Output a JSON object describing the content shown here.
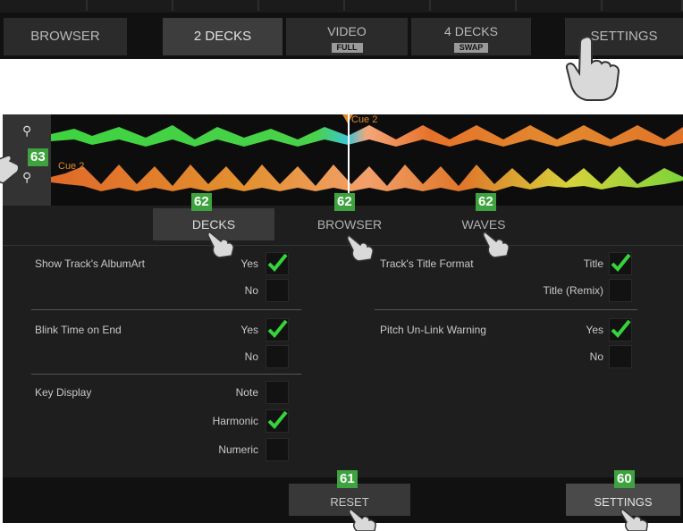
{
  "topnav": {
    "buttons": [
      {
        "label": "BROWSER"
      },
      {
        "label": "2 DECKS"
      },
      {
        "label": "VIDEO",
        "sublabel": "FULL"
      },
      {
        "label": "4 DECKS",
        "sublabel": "SWAP"
      },
      {
        "label": "SETTINGS"
      }
    ],
    "active": "2 DECKS"
  },
  "waveform": {
    "cue_top": "Cue 2",
    "cue_bottom": "Cue 2",
    "badge": "63",
    "colors": {
      "green": "#35c93a",
      "orange": "#e0762a",
      "yellow": "#d6d23c",
      "cyan": "#3bc7d6"
    }
  },
  "tabs": {
    "items": [
      {
        "label": "DECKS",
        "badge": "62"
      },
      {
        "label": "BROWSER",
        "badge": "62"
      },
      {
        "label": "WAVES",
        "badge": "62"
      }
    ],
    "active": "DECKS"
  },
  "settings": {
    "left": [
      {
        "label": "Show Track's AlbumArt",
        "options": [
          {
            "label": "Yes",
            "checked": true
          },
          {
            "label": "No",
            "checked": false
          }
        ]
      },
      {
        "label": "Blink Time on End",
        "options": [
          {
            "label": "Yes",
            "checked": true
          },
          {
            "label": "No",
            "checked": false
          }
        ]
      },
      {
        "label": "Key Display",
        "options": [
          {
            "label": "Note",
            "checked": false
          },
          {
            "label": "Harmonic",
            "checked": true
          },
          {
            "label": "Numeric",
            "checked": false
          }
        ]
      }
    ],
    "right": [
      {
        "label": "Track's Title Format",
        "options": [
          {
            "label": "Title",
            "checked": true
          },
          {
            "label": "Title (Remix)",
            "checked": false
          }
        ]
      },
      {
        "label": "Pitch Un-Link Warning",
        "options": [
          {
            "label": "Yes",
            "checked": true
          },
          {
            "label": "No",
            "checked": false
          }
        ]
      }
    ]
  },
  "bottom": {
    "reset": {
      "label": "RESET",
      "badge": "61"
    },
    "settings": {
      "label": "SETTINGS",
      "badge": "60"
    }
  },
  "icons": [
    "magnifier-icon",
    "pointing-hand-icon",
    "checkmark-icon",
    "cue-marker-icon"
  ]
}
